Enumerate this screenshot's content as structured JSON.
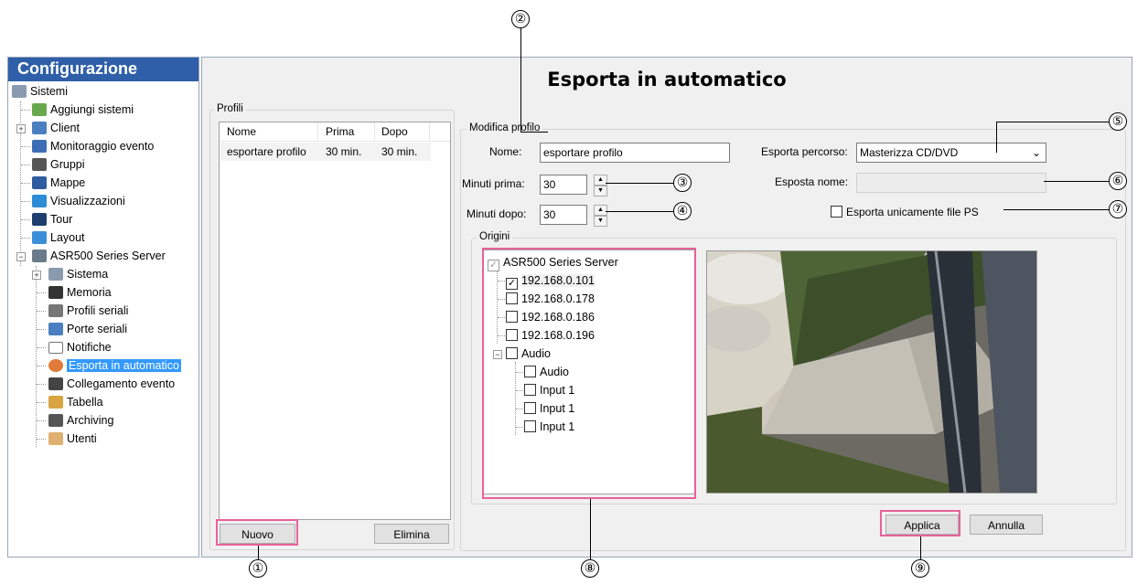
{
  "sidebar": {
    "title": "Configurazione",
    "items": [
      {
        "label": "Sistemi",
        "icon": "systems-icon"
      },
      {
        "label": "Aggiungi sistemi",
        "icon": "add-system-icon"
      },
      {
        "label": "Client",
        "icon": "client-icon"
      },
      {
        "label": "Monitoraggio evento",
        "icon": "event-monitor-icon"
      },
      {
        "label": "Gruppi",
        "icon": "groups-icon"
      },
      {
        "label": "Mappe",
        "icon": "maps-icon"
      },
      {
        "label": "Visualizzazioni",
        "icon": "views-icon"
      },
      {
        "label": "Tour",
        "icon": "tour-icon"
      },
      {
        "label": "Layout",
        "icon": "layout-icon"
      },
      {
        "label": "ASR500 Series Server",
        "icon": "server-icon"
      },
      {
        "label": "Sistema",
        "icon": "system-icon"
      },
      {
        "label": "Memoria",
        "icon": "storage-icon"
      },
      {
        "label": "Profili seriali",
        "icon": "serial-profiles-icon"
      },
      {
        "label": "Porte seriali",
        "icon": "serial-ports-icon"
      },
      {
        "label": "Notifiche",
        "icon": "envelope-icon"
      },
      {
        "label": "Esporta in automatico",
        "icon": "auto-export-icon"
      },
      {
        "label": "Collegamento evento",
        "icon": "event-link-icon"
      },
      {
        "label": "Tabella",
        "icon": "table-icon"
      },
      {
        "label": "Archiving",
        "icon": "archiving-icon"
      },
      {
        "label": "Utenti",
        "icon": "users-icon"
      }
    ]
  },
  "main": {
    "title": "Esporta in automatico",
    "profiles": {
      "legend": "Profili",
      "columns": [
        "Nome",
        "Prima",
        "Dopo"
      ],
      "rows": [
        [
          "esportare profilo",
          "30 min.",
          "30 min."
        ]
      ],
      "new_button": "Nuovo",
      "delete_button": "Elimina"
    },
    "edit": {
      "legend": "Modifica profilo",
      "name_label": "Nome:",
      "name_value": "esportare profilo",
      "minutes_before_label": "Minuti prima:",
      "minutes_before_value": "30",
      "minutes_after_label": "Minuti dopo:",
      "minutes_after_value": "30",
      "export_path_label": "Esporta percorso:",
      "export_path_value": "Masterizza CD/DVD",
      "export_name_label": "Esposta nome:",
      "export_name_value": "",
      "ps_only_label": "Esporta unicamente file PS",
      "ps_only_checked": false
    },
    "origins": {
      "legend": "Origini",
      "tree": [
        {
          "label": "ASR500 Series Server",
          "checked": true,
          "level": 0
        },
        {
          "label": "192.168.0.101",
          "checked": true,
          "level": 1
        },
        {
          "label": "192.168.0.178",
          "checked": false,
          "level": 1
        },
        {
          "label": "192.168.0.186",
          "checked": false,
          "level": 1
        },
        {
          "label": "192.168.0.196",
          "checked": false,
          "level": 1
        },
        {
          "label": "Audio",
          "checked": false,
          "level": 1
        },
        {
          "label": "Audio",
          "checked": false,
          "level": 2
        },
        {
          "label": "Input 1",
          "checked": false,
          "level": 2
        },
        {
          "label": "Input 1",
          "checked": false,
          "level": 2
        },
        {
          "label": "Input 1",
          "checked": false,
          "level": 2
        }
      ]
    },
    "apply_button": "Applica",
    "cancel_button": "Annulla"
  },
  "callouts": [
    "①",
    "②",
    "③",
    "④",
    "⑤",
    "⑥",
    "⑦",
    "⑧",
    "⑨"
  ],
  "colors": {
    "sidebar_header": "#2f5fa8",
    "selection": "#3399ff",
    "highlight": "#e8619a"
  }
}
